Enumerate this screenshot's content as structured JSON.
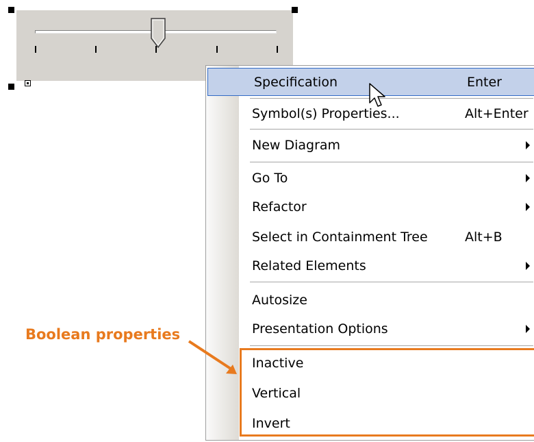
{
  "slider": {
    "value_fraction": 0.5,
    "tick_count": 5
  },
  "context_menu": {
    "items": [
      {
        "label": "Specification",
        "shortcut": "Enter",
        "submenu": false
      },
      {
        "label": "Symbol(s) Properties...",
        "shortcut": "Alt+Enter",
        "submenu": false
      },
      {
        "label": "New Diagram",
        "shortcut": "",
        "submenu": true
      },
      {
        "label": "Go To",
        "shortcut": "",
        "submenu": true
      },
      {
        "label": "Refactor",
        "shortcut": "",
        "submenu": true
      },
      {
        "label": "Select in Containment Tree",
        "shortcut": "Alt+B",
        "submenu": false
      },
      {
        "label": "Related Elements",
        "shortcut": "",
        "submenu": true
      },
      {
        "label": "Autosize",
        "shortcut": "",
        "submenu": false
      },
      {
        "label": "Presentation Options",
        "shortcut": "",
        "submenu": true
      },
      {
        "label": "Inactive",
        "shortcut": "",
        "submenu": false
      },
      {
        "label": "Vertical",
        "shortcut": "",
        "submenu": false
      },
      {
        "label": "Invert",
        "shortcut": "",
        "submenu": false
      }
    ]
  },
  "annotation": {
    "label": "Boolean properties",
    "color": "#e87a1e"
  },
  "colors": {
    "menu_highlight": "#c3d1ea",
    "menu_highlight_border": "#316ac5",
    "slider_body": "#d6d3ce"
  }
}
